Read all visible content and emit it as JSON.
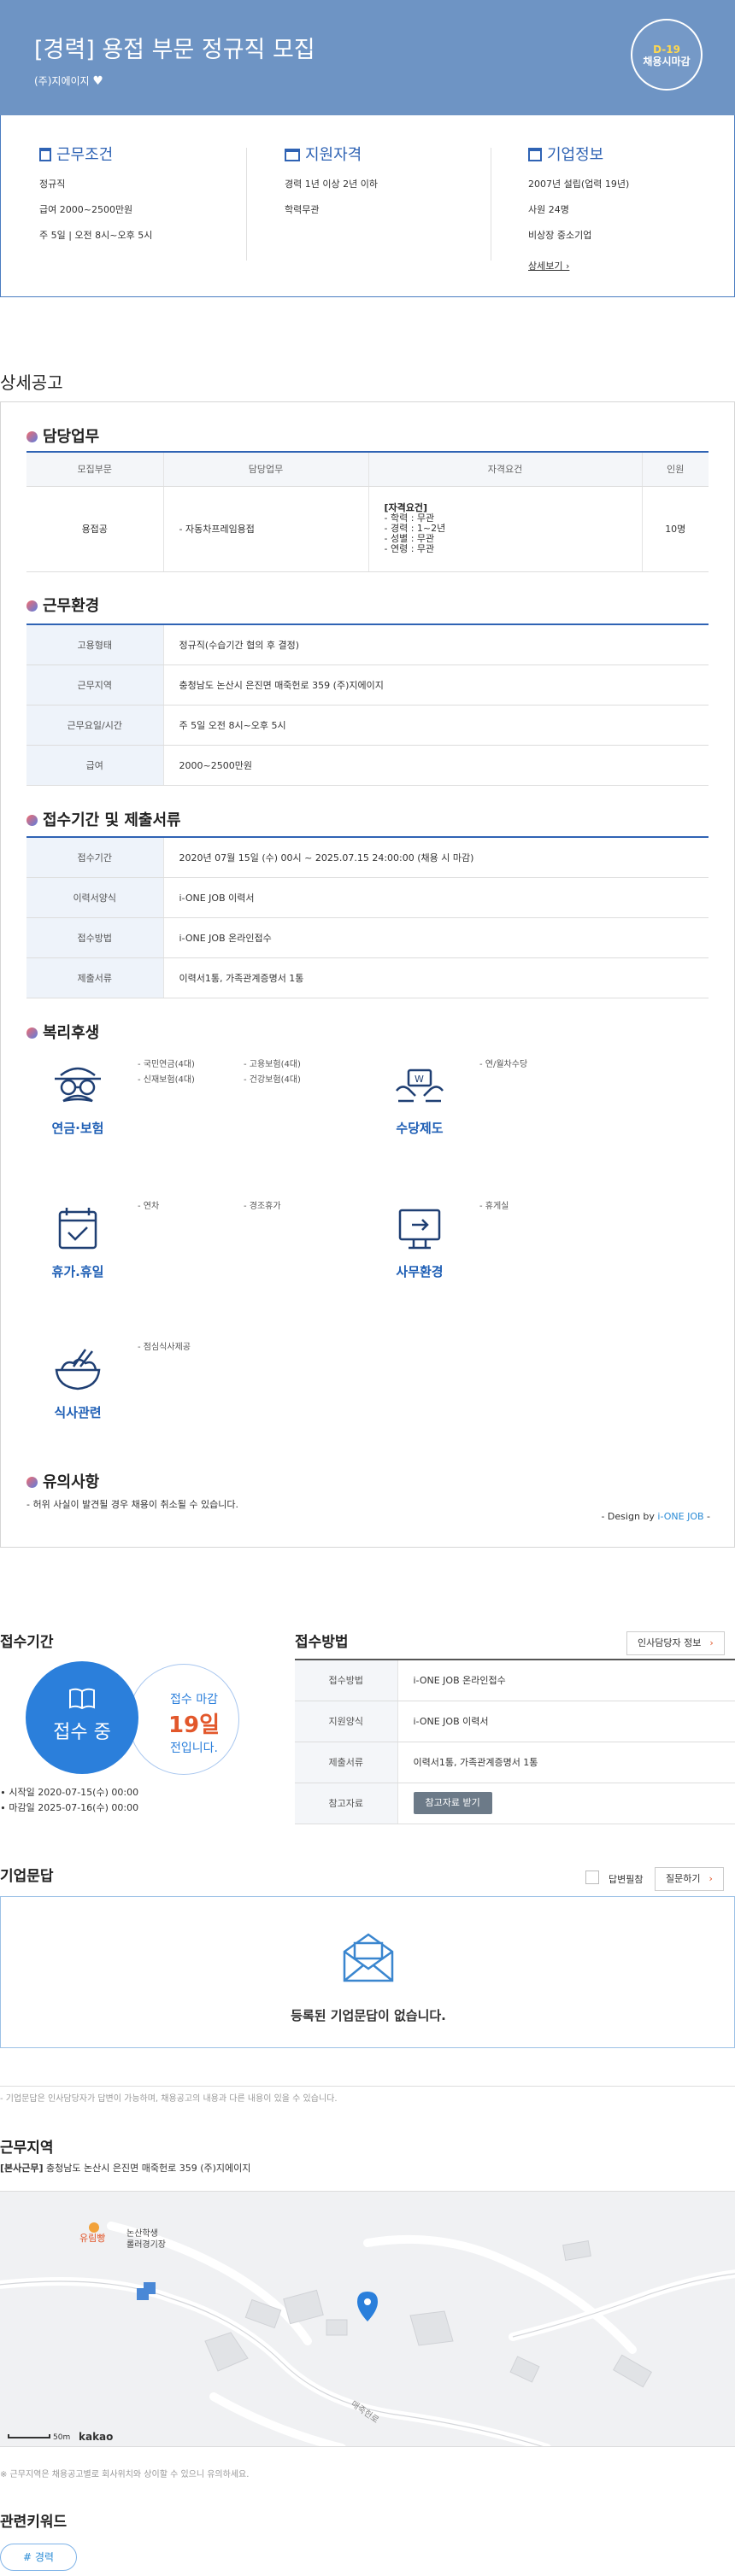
{
  "header": {
    "title": "[경력] 용접 부문 정규직 모집",
    "company": "(주)지에이지",
    "heart": "♥",
    "dday": "D-19",
    "dday_sub": "채용시마감"
  },
  "summary": {
    "cond": {
      "title": "근무조건",
      "lines": [
        "정규직",
        "급여 2000~2500만원",
        "주 5일 | 오전 8시~오후 5시"
      ]
    },
    "qual": {
      "title": "지원자격",
      "lines": [
        "경력 1년 이상 2년 이하",
        "학력무관"
      ]
    },
    "corp": {
      "title": "기업정보",
      "lines": [
        "2007년 설립(업력 19년)",
        "사원 24명",
        "비상장 중소기업"
      ],
      "more": "상세보기 ›"
    }
  },
  "detail_title": "상세공고",
  "duty": {
    "title": "담당업무",
    "headers": [
      "모집부문",
      "담당업무",
      "자격요건",
      "인원"
    ],
    "row": {
      "part": "용접공",
      "task": "- 자동차프레임용접",
      "req_head": "[자격요건]",
      "req": [
        "- 학력 : 무관",
        "- 경력 : 1~2년",
        "- 성별 : 무관",
        "- 연령 : 무관"
      ],
      "count": "10명"
    }
  },
  "env": {
    "title": "근무환경",
    "rows": [
      {
        "k": "고용형태",
        "v": "정규직(수습기간 협의 후 결정)"
      },
      {
        "k": "근무지역",
        "v": "충청남도 논산시 은진면 매죽헌로 359 (주)지에이지"
      },
      {
        "k": "근무요일/시간",
        "v": "주 5일 오전 8시~오후 5시"
      },
      {
        "k": "급여",
        "v": "2000~2500만원"
      }
    ]
  },
  "apply": {
    "title": "접수기간 및 제출서류",
    "rows": [
      {
        "k": "접수기간",
        "v": "2020년 07월 15일 (수) 00시 ~ 2025.07.15 24:00:00 (채용 시 마감)"
      },
      {
        "k": "이력서양식",
        "v": "i-ONE JOB 이력서"
      },
      {
        "k": "접수방법",
        "v": "i-ONE JOB 온라인접수"
      },
      {
        "k": "제출서류",
        "v": "이력서1통, 가족관계증명서 1통"
      }
    ]
  },
  "welfare": {
    "title": "복리후생",
    "items": [
      {
        "label": "연금·보험",
        "notes": [
          "- 국민연금(4대)",
          "- 신재보험(4대)",
          "- 고용보험(4대)",
          "- 건강보험(4대)"
        ]
      },
      {
        "label": "수당제도",
        "notes": [
          "- 연/월차수당"
        ]
      },
      {
        "label": "휴가.휴일",
        "notes": [
          "- 연차",
          "- 경조휴가"
        ]
      },
      {
        "label": "사무환경",
        "notes": [
          "- 휴게실"
        ]
      },
      {
        "label": "식사관련",
        "notes": [
          "- 점심식사제공"
        ]
      }
    ]
  },
  "notice": {
    "title": "유의사항",
    "text": "- 허위 사실이 발견될 경우 채용이 취소될 수 있습니다.",
    "design_prefix": "- Design by ",
    "design_brand": "i-ONE JOB",
    "design_suffix": " -"
  },
  "period": {
    "title": "접수기간",
    "status": "접수 중",
    "deadline_label": "접수 마감",
    "days": "19일",
    "days_suffix": "전입니다.",
    "start": "시작일 2020-07-15(수) 00:00",
    "end": "마감일 2025-07-16(수) 00:00"
  },
  "method": {
    "title": "접수방법",
    "hr_button": "인사담당자 정보",
    "rows": [
      {
        "k": "접수방법",
        "v": "i-ONE JOB 온라인접수"
      },
      {
        "k": "지원양식",
        "v": "i-ONE JOB 이력서"
      },
      {
        "k": "제출서류",
        "v": "이력서1통, 가족관계증명서 1통"
      },
      {
        "k": "참고자료",
        "v": ""
      }
    ],
    "ref_button": "참고자료 받기"
  },
  "qna": {
    "title": "기업문답",
    "check_label": "답변필참",
    "ask_button": "질문하기",
    "empty": "등록된 기업문답이 없습니다.",
    "note": "- 기업문답은 인사담당자가 답변이 가능하며, 채용공고의 내용과 다른 내용이 있을 수 있습니다."
  },
  "location": {
    "title": "근무지역",
    "tag": "[본사근무]",
    "address": "충청남도 논산시 은진면 매죽헌로 359 (주)지에이지",
    "map_place1": "유림빵",
    "map_place2": "논산학생",
    "map_place3": "롤러경기장",
    "map_road": "매죽헌로",
    "scale": "50m",
    "map_brand": "kakao",
    "note": "※ 근무지역은 채용공고별로 회사위치와 상이할 수 있으니 유의하세요."
  },
  "keywords": {
    "title": "관련키워드",
    "items": [
      "# 경력"
    ]
  },
  "colors": {
    "hero": "#6e94c4",
    "accent": "#2f63b4",
    "link": "#2a8bd6",
    "orange": "#e2572b"
  }
}
